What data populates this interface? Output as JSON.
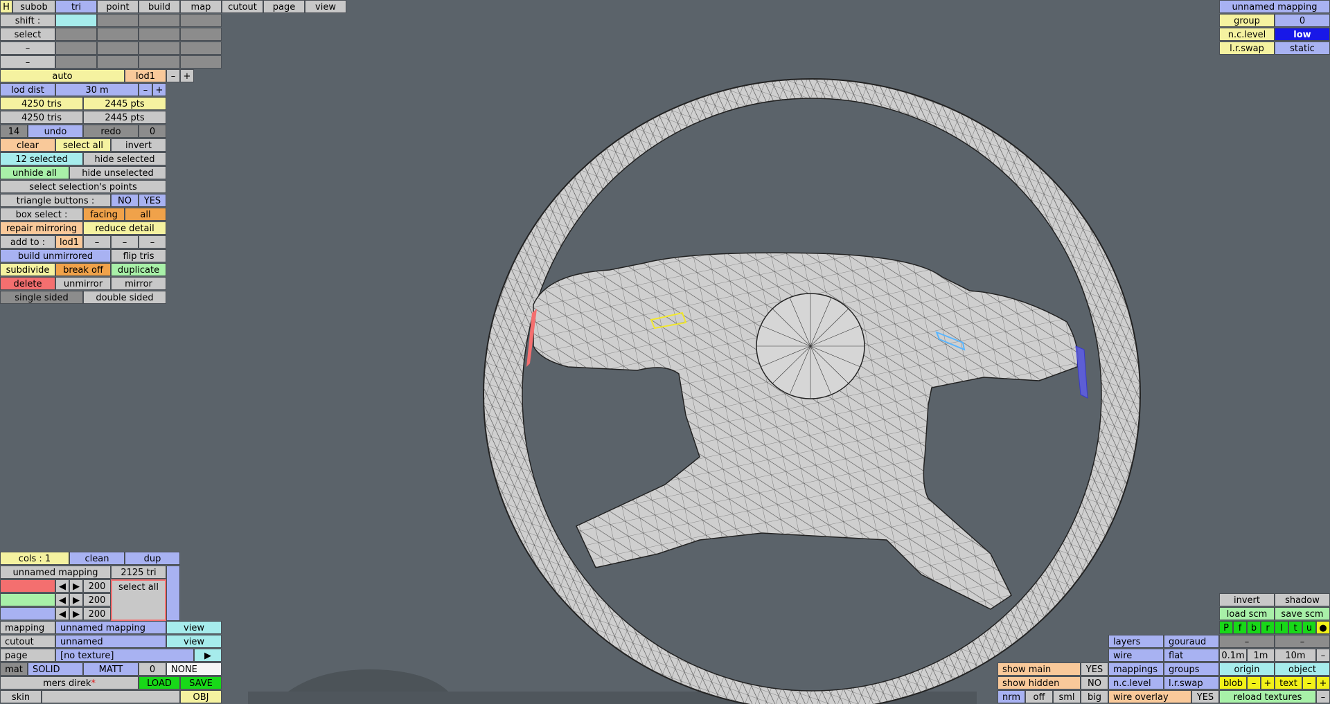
{
  "top_tabs": [
    "H",
    "subob",
    "tri",
    "point",
    "build",
    "map",
    "cutout",
    "page",
    "view"
  ],
  "shift_label": "shift :",
  "select_label": "select",
  "dash": "–",
  "lod": {
    "auto": "auto",
    "name": "lod1",
    "minus": "–",
    "plus": "+",
    "dist_label": "lod dist",
    "dist_value": "30 m"
  },
  "stats": {
    "tris1": "4250 tris",
    "pts1": "2445 pts",
    "tris2": "4250 tris",
    "pts2": "2445 pts"
  },
  "undo": {
    "count": "14",
    "undo": "undo",
    "redo": "redo",
    "redo_count": "0"
  },
  "sel": {
    "clear": "clear",
    "select_all": "select all",
    "invert": "invert",
    "selected": "12 selected",
    "hide_selected": "hide selected",
    "unhide_all": "unhide all",
    "hide_unselected": "hide unselected",
    "select_points": "select selection's points"
  },
  "tri_buttons": {
    "label": "triangle buttons :",
    "no": "NO",
    "yes": "YES"
  },
  "box_select": {
    "label": "box select :",
    "facing": "facing",
    "all": "all"
  },
  "repair": {
    "repair": "repair mirroring",
    "reduce": "reduce detail"
  },
  "add_to": {
    "label": "add to :",
    "lod": "lod1"
  },
  "ops": {
    "build_unmirrored": "build unmirrored",
    "flip_tris": "flip tris",
    "subdivide": "subdivide",
    "break_off": "break off",
    "duplicate": "duplicate",
    "delete": "delete",
    "unmirror": "unmirror",
    "mirror": "mirror",
    "single_sided": "single sided",
    "double_sided": "double sided"
  },
  "cols": {
    "label": "cols : 1",
    "clean": "clean",
    "dup": "dup"
  },
  "mapping_info": {
    "name": "unnamed mapping",
    "tri": "2125 tri"
  },
  "sliders": {
    "v1": "200",
    "v2": "200",
    "v3": "200",
    "select_all": "select all",
    "prev": "◀",
    "next": "▶"
  },
  "bottom_left": {
    "mapping_label": "mapping",
    "mapping_value": "unnamed mapping",
    "view": "view",
    "cutout_label": "cutout",
    "cutout_value": "unnamed",
    "page_label": "page",
    "page_value": "[no texture]",
    "page_arrow": "▶",
    "mat": "mat",
    "solid": "SOLID",
    "matt": "MATT",
    "zero": "0",
    "none": "NONE",
    "file": "mers direk",
    "star": "*",
    "load": "LOAD",
    "save": "SAVE",
    "skin": "skin",
    "obj": "OBJ"
  },
  "top_right": {
    "title": "unnamed mapping",
    "group_label": "group",
    "group_value": "0",
    "nc_label": "n.c.level",
    "nc_value": "low",
    "lr_label": "l.r.swap",
    "lr_value": "static"
  },
  "bottom_right": {
    "invert": "invert",
    "shadow": "shadow",
    "load_scm": "load scm",
    "save_scm": "save scm",
    "letters": [
      "P",
      "f",
      "b",
      "r",
      "l",
      "t",
      "u",
      "●"
    ],
    "layers": "layers",
    "gouraud": "gouraud",
    "wire": "wire",
    "flat": "flat",
    "d01": "0.1m",
    "d1": "1m",
    "d10": "10m",
    "mappings": "mappings",
    "groups": "groups",
    "origin": "origin",
    "object": "object",
    "nc": "n.c.level",
    "lr": "l.r.swap",
    "blob": "blob",
    "text": "text",
    "show_main": "show main",
    "show_main_v": "YES",
    "show_hidden": "show hidden",
    "show_hidden_v": "NO",
    "nrm": "nrm",
    "off": "off",
    "sml": "sml",
    "big": "big",
    "wire_overlay": "wire overlay",
    "wire_overlay_v": "YES",
    "reload": "reload textures"
  }
}
